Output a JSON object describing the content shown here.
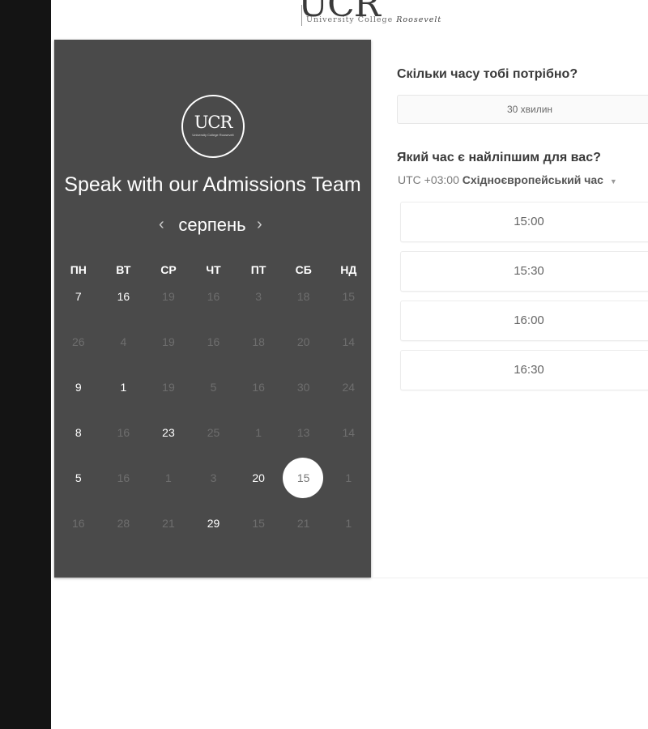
{
  "brand": {
    "mark": "UCR",
    "subtitle_plain": "University College",
    "subtitle_italic": "Roosevelt"
  },
  "panel": {
    "logo_text": "UCR",
    "logo_tagline": "University College Roosevelt",
    "headline": "Speak with our Admissions Team",
    "month": "серпень",
    "prev_icon": "‹",
    "next_icon": "›",
    "weekdays": [
      "ПН",
      "ВТ",
      "СР",
      "ЧТ",
      "ПТ",
      "СБ",
      "НД"
    ],
    "weeks": [
      [
        {
          "d": "7",
          "s": "on"
        },
        {
          "d": "16",
          "s": "on"
        },
        {
          "d": "19",
          "s": "off"
        },
        {
          "d": "16",
          "s": "off"
        },
        {
          "d": "3",
          "s": "off"
        },
        {
          "d": "18",
          "s": "off"
        },
        {
          "d": "15",
          "s": "off"
        }
      ],
      [
        {
          "d": "26",
          "s": "off"
        },
        {
          "d": "4",
          "s": "off"
        },
        {
          "d": "19",
          "s": "off"
        },
        {
          "d": "16",
          "s": "off"
        },
        {
          "d": "18",
          "s": "off"
        },
        {
          "d": "20",
          "s": "off"
        },
        {
          "d": "14",
          "s": "off"
        }
      ],
      [
        {
          "d": "9",
          "s": "on"
        },
        {
          "d": "1",
          "s": "on"
        },
        {
          "d": "19",
          "s": "off"
        },
        {
          "d": "5",
          "s": "off"
        },
        {
          "d": "16",
          "s": "off"
        },
        {
          "d": "30",
          "s": "off"
        },
        {
          "d": "24",
          "s": "off"
        }
      ],
      [
        {
          "d": "8",
          "s": "on"
        },
        {
          "d": "16",
          "s": "off"
        },
        {
          "d": "23",
          "s": "on"
        },
        {
          "d": "25",
          "s": "off"
        },
        {
          "d": "1",
          "s": "off"
        },
        {
          "d": "13",
          "s": "off"
        },
        {
          "d": "14",
          "s": "off"
        }
      ],
      [
        {
          "d": "5",
          "s": "on"
        },
        {
          "d": "16",
          "s": "off"
        },
        {
          "d": "1",
          "s": "off"
        },
        {
          "d": "3",
          "s": "off"
        },
        {
          "d": "20",
          "s": "on"
        },
        {
          "d": "15",
          "s": "sel"
        },
        {
          "d": "1",
          "s": "off"
        }
      ],
      [
        {
          "d": "16",
          "s": "off"
        },
        {
          "d": "28",
          "s": "off"
        },
        {
          "d": "21",
          "s": "off"
        },
        {
          "d": "29",
          "s": "on"
        },
        {
          "d": "15",
          "s": "off"
        },
        {
          "d": "21",
          "s": "off"
        },
        {
          "d": "1",
          "s": "off"
        }
      ]
    ]
  },
  "booking": {
    "duration_question": "Скільки часу тобі потрібно?",
    "duration_value": "30 хвилин",
    "time_question": "Який час є найліпшим для вас?",
    "tz_offset": "UTC +03:00",
    "tz_name": "Східноєвропейський час",
    "tz_caret": "▼",
    "slots": [
      "15:00",
      "15:30",
      "16:00",
      "16:30"
    ]
  }
}
